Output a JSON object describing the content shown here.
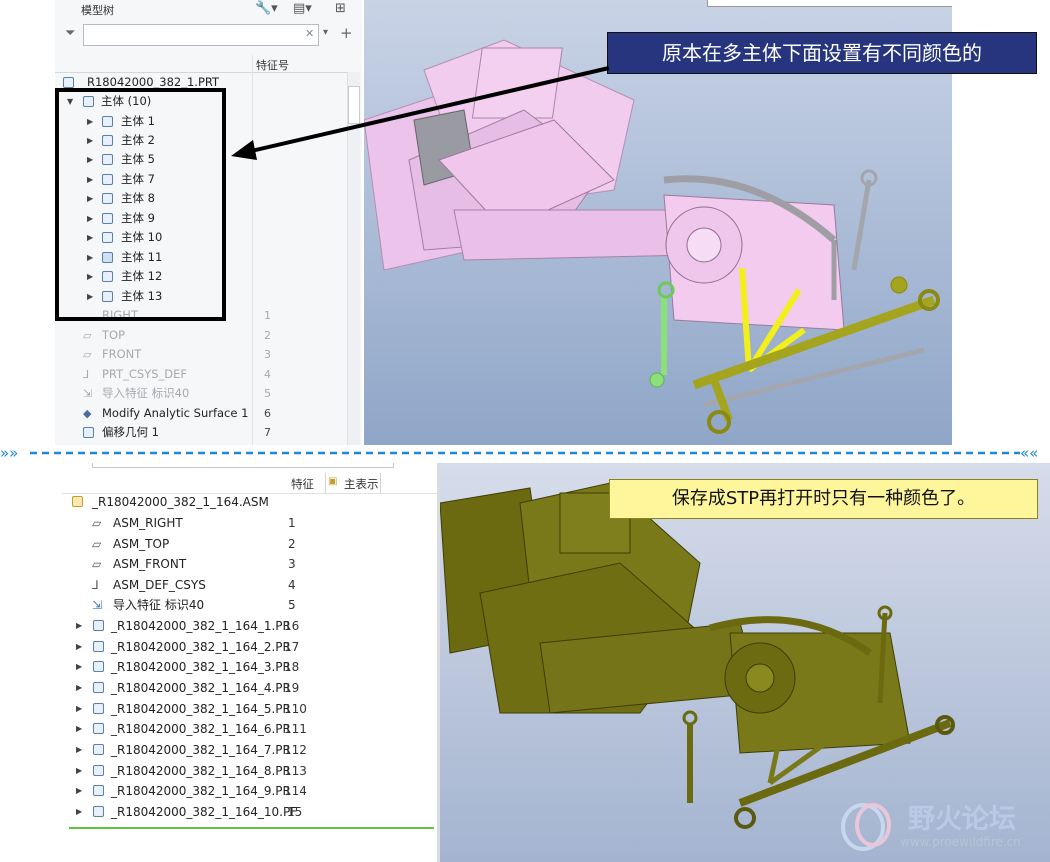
{
  "top_panel": {
    "tree_title": "模型树",
    "column_header": "特征号",
    "root_part": "R18042000_382_1.PRT",
    "bodies_group": "主体 (10)",
    "bodies": [
      "主体 1",
      "主体 2",
      "主体 5",
      "主体 7",
      "主体 8",
      "主体 9",
      "主体 10",
      "主体 11",
      "主体 12",
      "主体 13"
    ],
    "features": [
      {
        "name": "RIGHT",
        "num": "1"
      },
      {
        "name": "TOP",
        "num": "2"
      },
      {
        "name": "FRONT",
        "num": "3"
      },
      {
        "name": "PRT_CSYS_DEF",
        "num": "4"
      },
      {
        "name": "导入特征 标识40",
        "num": "5"
      },
      {
        "name": "Modify Analytic Surface 1",
        "num": "6"
      },
      {
        "name": "偏移几何 1",
        "num": "7"
      }
    ],
    "callout": "原本在多主体下面设置有不同颜色的"
  },
  "bottom_panel": {
    "col_feature": "特征",
    "col_main": "主表示",
    "root_asm": "_R18042000_382_1_164.ASM",
    "datums": [
      {
        "name": "ASM_RIGHT",
        "num": "1"
      },
      {
        "name": "ASM_TOP",
        "num": "2"
      },
      {
        "name": "ASM_FRONT",
        "num": "3"
      },
      {
        "name": "ASM_DEF_CSYS",
        "num": "4"
      },
      {
        "name": "导入特征 标识40",
        "num": "5"
      }
    ],
    "parts": [
      {
        "name": "_R18042000_382_1_164_1.PR",
        "num": "16"
      },
      {
        "name": "_R18042000_382_1_164_2.PR",
        "num": "17"
      },
      {
        "name": "_R18042000_382_1_164_3.PR",
        "num": "18"
      },
      {
        "name": "_R18042000_382_1_164_4.PR",
        "num": "19"
      },
      {
        "name": "_R18042000_382_1_164_5.PR",
        "num": "110"
      },
      {
        "name": "_R18042000_382_1_164_6.PR",
        "num": "111"
      },
      {
        "name": "_R18042000_382_1_164_7.PR",
        "num": "112"
      },
      {
        "name": "_R18042000_382_1_164_8.PR",
        "num": "113"
      },
      {
        "name": "_R18042000_382_1_164_9.PR",
        "num": "114"
      },
      {
        "name": "_R18042000_382_1_164_10.PF",
        "num": "15"
      }
    ],
    "callout": "保存成STP再打开时只有一种颜色了。"
  },
  "watermark": {
    "title": "野火论坛",
    "url": "www.proewildfire.cn"
  },
  "colors": {
    "callout_top_bg": "#26357e",
    "callout_bot_bg": "#fff59a",
    "model_pink": "#f2c8ee",
    "model_olive": "#6b6a10",
    "accent_yellow": "#f2ef1a",
    "accent_green": "#8be07a",
    "divider_blue": "#1e88d8"
  }
}
